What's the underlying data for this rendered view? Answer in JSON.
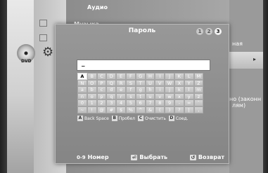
{
  "background_menu": {
    "category_title": "Аудио",
    "item_music": "Музыка",
    "disc_label": "DVD",
    "right_text_1": "ная",
    "right_arrow": "▸",
    "right_text_2": "но (законн",
    "right_text_3": "лям)"
  },
  "dialog": {
    "title": "Пароль",
    "steps": [
      "1",
      "2",
      "3"
    ],
    "active_step": "3",
    "input_value": "_"
  },
  "keyboard": {
    "rows": [
      [
        "A",
        "B",
        "C",
        "D",
        "E",
        "F",
        "G",
        "H",
        "I",
        "J",
        "K",
        "L",
        "M"
      ],
      [
        "N",
        "O",
        "P",
        "Q",
        "R",
        "S",
        "T",
        "U",
        "V",
        "W",
        "X",
        "Y",
        "Z"
      ],
      [
        "a",
        "b",
        "c",
        "d",
        "e",
        "f",
        "g",
        "h",
        "i",
        "j",
        "k",
        "l",
        "m"
      ],
      [
        "n",
        "o",
        "p",
        "q",
        "r",
        "s",
        "t",
        "u",
        "v",
        "w",
        "x",
        "y",
        "z"
      ],
      [
        "0",
        "1",
        "2",
        "3",
        "4",
        "5",
        "6",
        "7",
        "8",
        "9",
        "-",
        "=",
        "`"
      ],
      [
        "~",
        "!",
        "@",
        "#",
        "$",
        "%",
        "^",
        "&",
        "(",
        ")",
        "?",
        "|",
        ","
      ]
    ],
    "selected": "A",
    "actions": [
      {
        "badge": "A",
        "label": "Back Space"
      },
      {
        "badge": "B",
        "label": "Пробел"
      },
      {
        "badge": "C",
        "label": "Очистить"
      },
      {
        "badge": "D",
        "label": "Соед."
      }
    ]
  },
  "footer": {
    "number_icon": "0-9",
    "number_label": "Номер",
    "enter_icon": "⏎",
    "enter_label": "Выбрать",
    "return_icon": "↺",
    "return_label": "Возврат"
  }
}
